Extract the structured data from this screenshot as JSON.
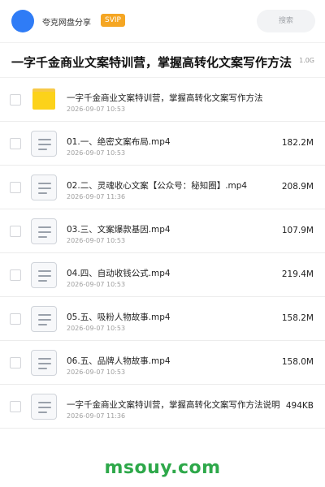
{
  "header": {
    "share_name": "夸克网盘分享",
    "badge": "SVIP",
    "search_placeholder": "搜索"
  },
  "share": {
    "title": "一字千金商业文案特训营，掌握高转化文案写作方法",
    "total_size": "1.0G"
  },
  "files": [
    {
      "name": "一字千金商业文案特训营，掌握高转化文案写作方法",
      "date": "2026-09-07 10:53",
      "size": "",
      "type": "folder"
    },
    {
      "name": "01.一、绝密文案布局.mp4",
      "date": "2026-09-07 10:53",
      "size": "182.2M",
      "type": "file"
    },
    {
      "name": "02.二、灵魂收心文案【公众号：秘知圈】.mp4",
      "date": "2026-09-07 11:36",
      "size": "208.9M",
      "type": "file"
    },
    {
      "name": "03.三、文案爆款基因.mp4",
      "date": "2026-09-07 10:53",
      "size": "107.9M",
      "type": "file"
    },
    {
      "name": "04.四、自动收钱公式.mp4",
      "date": "2026-09-07 10:53",
      "size": "219.4M",
      "type": "file"
    },
    {
      "name": "05.五、吸粉人物故事.mp4",
      "date": "2026-09-07 10:53",
      "size": "158.2M",
      "type": "file"
    },
    {
      "name": "06.五、品牌人物故事.mp4",
      "date": "2026-09-07 10:53",
      "size": "158.0M",
      "type": "file"
    },
    {
      "name": "一字千金商业文案特训营，掌握高转化文案写作方法说明",
      "date": "2026-09-07 11:36",
      "size": "494KB",
      "type": "file"
    }
  ],
  "watermark": "msouy.com",
  "colors": {
    "accent": "#2f7cf6",
    "svip": "#f5a623",
    "folder": "#fcd21a",
    "watermark": "#2ea84a"
  }
}
